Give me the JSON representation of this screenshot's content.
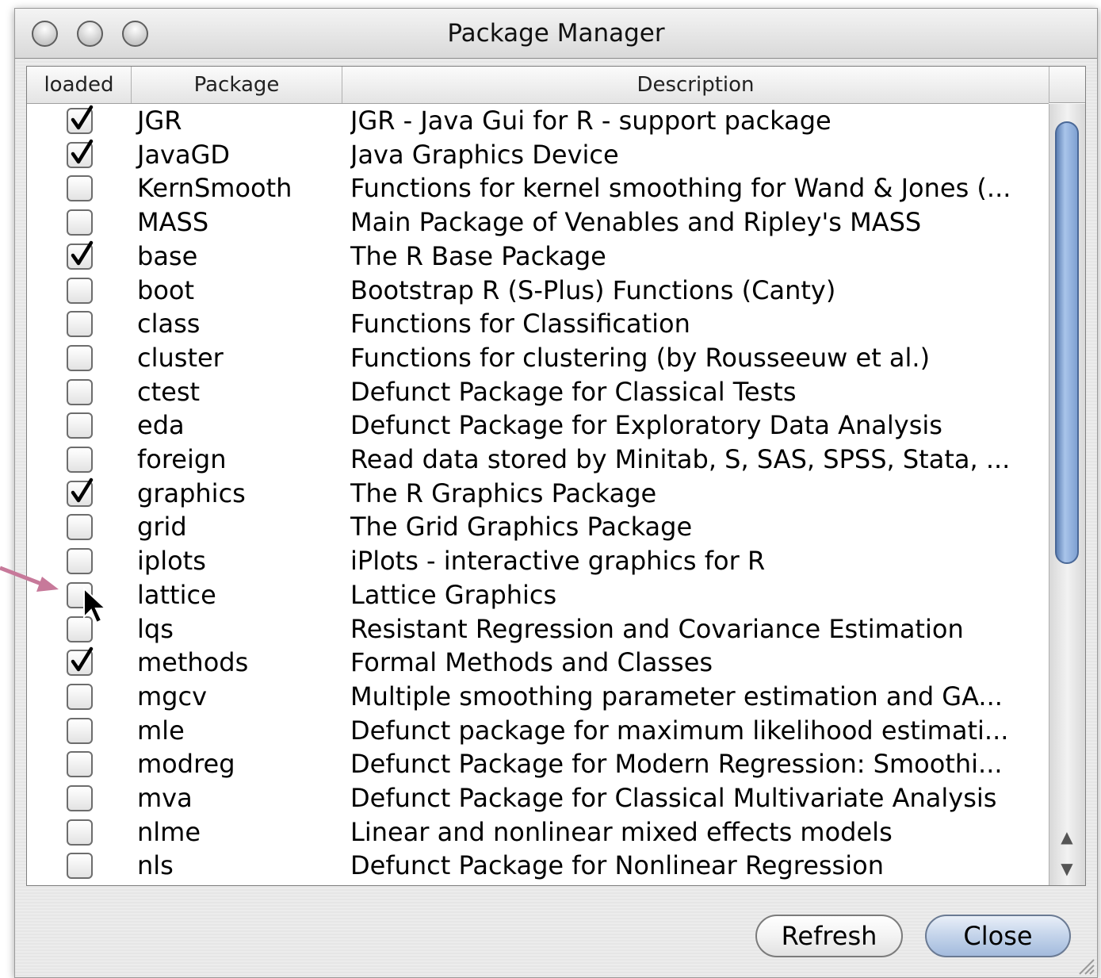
{
  "window": {
    "title": "Package Manager"
  },
  "table": {
    "columns": [
      "loaded",
      "Package",
      "Description"
    ],
    "rows": [
      {
        "loaded": true,
        "package": "JGR",
        "description": "JGR - Java Gui for R - support package"
      },
      {
        "loaded": true,
        "package": "JavaGD",
        "description": "Java Graphics Device"
      },
      {
        "loaded": false,
        "package": "KernSmooth",
        "description": "Functions for kernel smoothing for Wand & Jones (..."
      },
      {
        "loaded": false,
        "package": "MASS",
        "description": "Main Package of Venables and Ripley's MASS"
      },
      {
        "loaded": true,
        "package": "base",
        "description": "The R Base Package"
      },
      {
        "loaded": false,
        "package": "boot",
        "description": "Bootstrap R (S-Plus) Functions (Canty)"
      },
      {
        "loaded": false,
        "package": "class",
        "description": "Functions for Classification"
      },
      {
        "loaded": false,
        "package": "cluster",
        "description": "Functions for clustering (by Rousseeuw et al.)"
      },
      {
        "loaded": false,
        "package": "ctest",
        "description": "Defunct Package for Classical Tests"
      },
      {
        "loaded": false,
        "package": "eda",
        "description": "Defunct Package for Exploratory Data Analysis"
      },
      {
        "loaded": false,
        "package": "foreign",
        "description": "Read data stored by Minitab, S, SAS, SPSS, Stata, ..."
      },
      {
        "loaded": true,
        "package": "graphics",
        "description": "The R Graphics Package"
      },
      {
        "loaded": false,
        "package": "grid",
        "description": "The Grid Graphics Package"
      },
      {
        "loaded": false,
        "package": "iplots",
        "description": "iPlots - interactive graphics for R"
      },
      {
        "loaded": false,
        "package": "lattice",
        "description": "Lattice Graphics"
      },
      {
        "loaded": false,
        "package": "lqs",
        "description": "Resistant Regression and Covariance Estimation"
      },
      {
        "loaded": true,
        "package": "methods",
        "description": "Formal Methods and Classes"
      },
      {
        "loaded": false,
        "package": "mgcv",
        "description": "Multiple smoothing parameter estimation and GA..."
      },
      {
        "loaded": false,
        "package": "mle",
        "description": "Defunct package for maximum likelihood estimati..."
      },
      {
        "loaded": false,
        "package": "modreg",
        "description": "Defunct Package for Modern Regression: Smoothi..."
      },
      {
        "loaded": false,
        "package": "mva",
        "description": "Defunct Package for Classical Multivariate Analysis"
      },
      {
        "loaded": false,
        "package": "nlme",
        "description": "Linear and nonlinear mixed effects models"
      },
      {
        "loaded": false,
        "package": "nls",
        "description": "Defunct Package for Nonlinear Regression"
      }
    ]
  },
  "buttons": {
    "refresh": "Refresh",
    "close": "Close"
  },
  "colors": {
    "annotation_arrow": "#c7799a",
    "scroll_thumb": "#7fa1d2"
  },
  "icons": [
    "close-window-icon",
    "minimize-window-icon",
    "zoom-window-icon",
    "checkmark-icon",
    "scroll-up-arrow-icon",
    "scroll-down-arrow-icon",
    "mouse-pointer-icon",
    "resize-grip-icon",
    "annotation-arrow-icon"
  ]
}
